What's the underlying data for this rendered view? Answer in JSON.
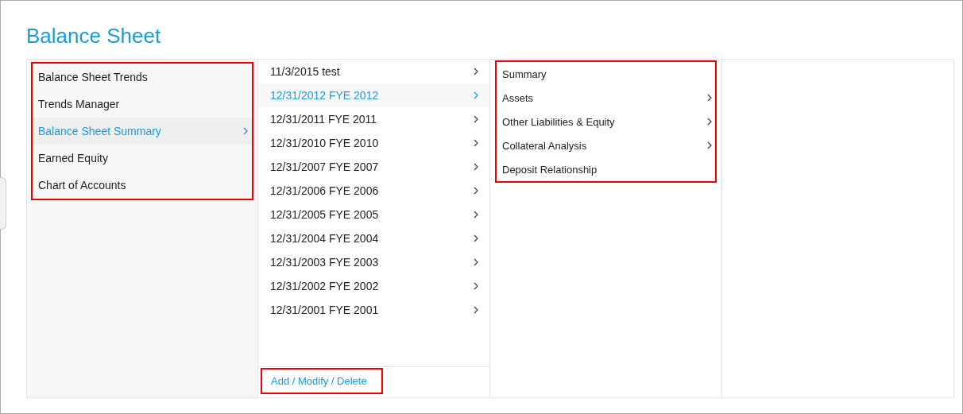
{
  "title": "Balance Sheet",
  "columns": [
    {
      "highlighted": true,
      "items": [
        {
          "label": "Balance Sheet Trends",
          "selected": false,
          "arrow": false
        },
        {
          "label": "Trends Manager",
          "selected": false,
          "arrow": false
        },
        {
          "label": "Balance Sheet Summary",
          "selected": true,
          "arrow": true
        },
        {
          "label": "Earned Equity",
          "selected": false,
          "arrow": false
        },
        {
          "label": "Chart of Accounts",
          "selected": false,
          "arrow": false
        }
      ]
    },
    {
      "highlighted": false,
      "items": [
        {
          "label": "11/3/2015 test",
          "selected": false,
          "arrow": true
        },
        {
          "label": "12/31/2012 FYE 2012",
          "selected": true,
          "arrow": true
        },
        {
          "label": "12/31/2011 FYE 2011",
          "selected": false,
          "arrow": true
        },
        {
          "label": "12/31/2010 FYE 2010",
          "selected": false,
          "arrow": true
        },
        {
          "label": "12/31/2007 FYE 2007",
          "selected": false,
          "arrow": true
        },
        {
          "label": "12/31/2006 FYE 2006",
          "selected": false,
          "arrow": true
        },
        {
          "label": "12/31/2005 FYE 2005",
          "selected": false,
          "arrow": true
        },
        {
          "label": "12/31/2004 FYE 2004",
          "selected": false,
          "arrow": true
        },
        {
          "label": "12/31/2003 FYE 2003",
          "selected": false,
          "arrow": true
        },
        {
          "label": "12/31/2002 FYE 2002",
          "selected": false,
          "arrow": true
        },
        {
          "label": "12/31/2001 FYE 2001",
          "selected": false,
          "arrow": true
        }
      ],
      "footer": {
        "label": "Add / Modify / Delete",
        "highlighted": true
      }
    },
    {
      "highlighted": true,
      "items": [
        {
          "label": "Summary",
          "selected": false,
          "arrow": false
        },
        {
          "label": "Assets",
          "selected": false,
          "arrow": true
        },
        {
          "label": "Other Liabilities & Equity",
          "selected": false,
          "arrow": true
        },
        {
          "label": "Collateral Analysis",
          "selected": false,
          "arrow": true
        },
        {
          "label": "Deposit Relationship",
          "selected": false,
          "arrow": false
        }
      ]
    },
    {
      "highlighted": false
    }
  ]
}
